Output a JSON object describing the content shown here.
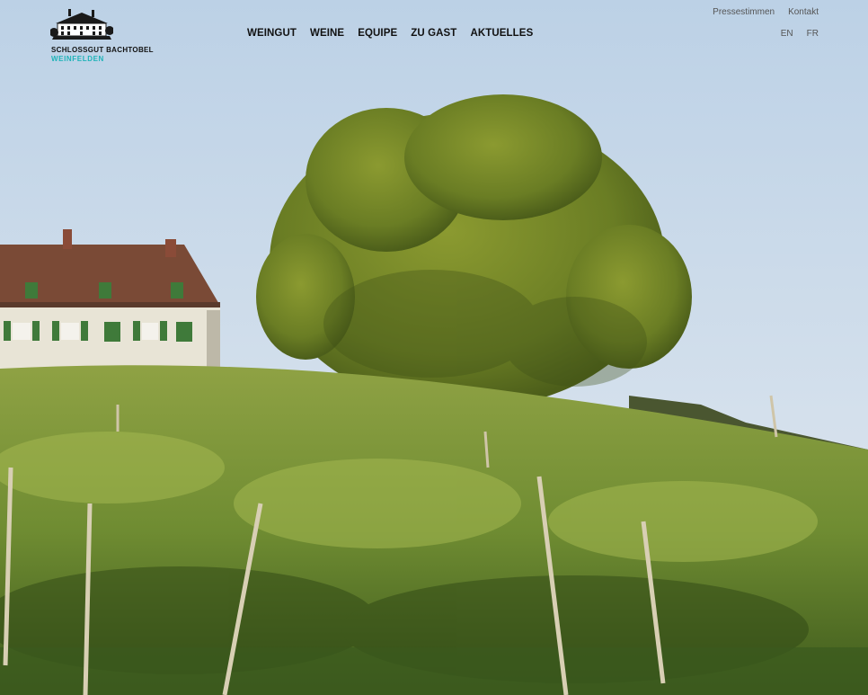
{
  "logo": {
    "line1": "SCHLOSSGUT BACHTOBEL",
    "line2": "WEINFELDEN",
    "accent_color": "#1fb3b8"
  },
  "nav": {
    "items": [
      {
        "label": "WEINGUT"
      },
      {
        "label": "WEINE"
      },
      {
        "label": "EQUIPE"
      },
      {
        "label": "ZU GAST"
      },
      {
        "label": "AKTUELLES"
      }
    ]
  },
  "top_links": [
    {
      "label": "Pressestimmen"
    },
    {
      "label": "Kontakt"
    }
  ],
  "languages": [
    {
      "label": "EN"
    },
    {
      "label": "FR"
    }
  ],
  "hero": {
    "description_icon": "vineyard-photo"
  }
}
